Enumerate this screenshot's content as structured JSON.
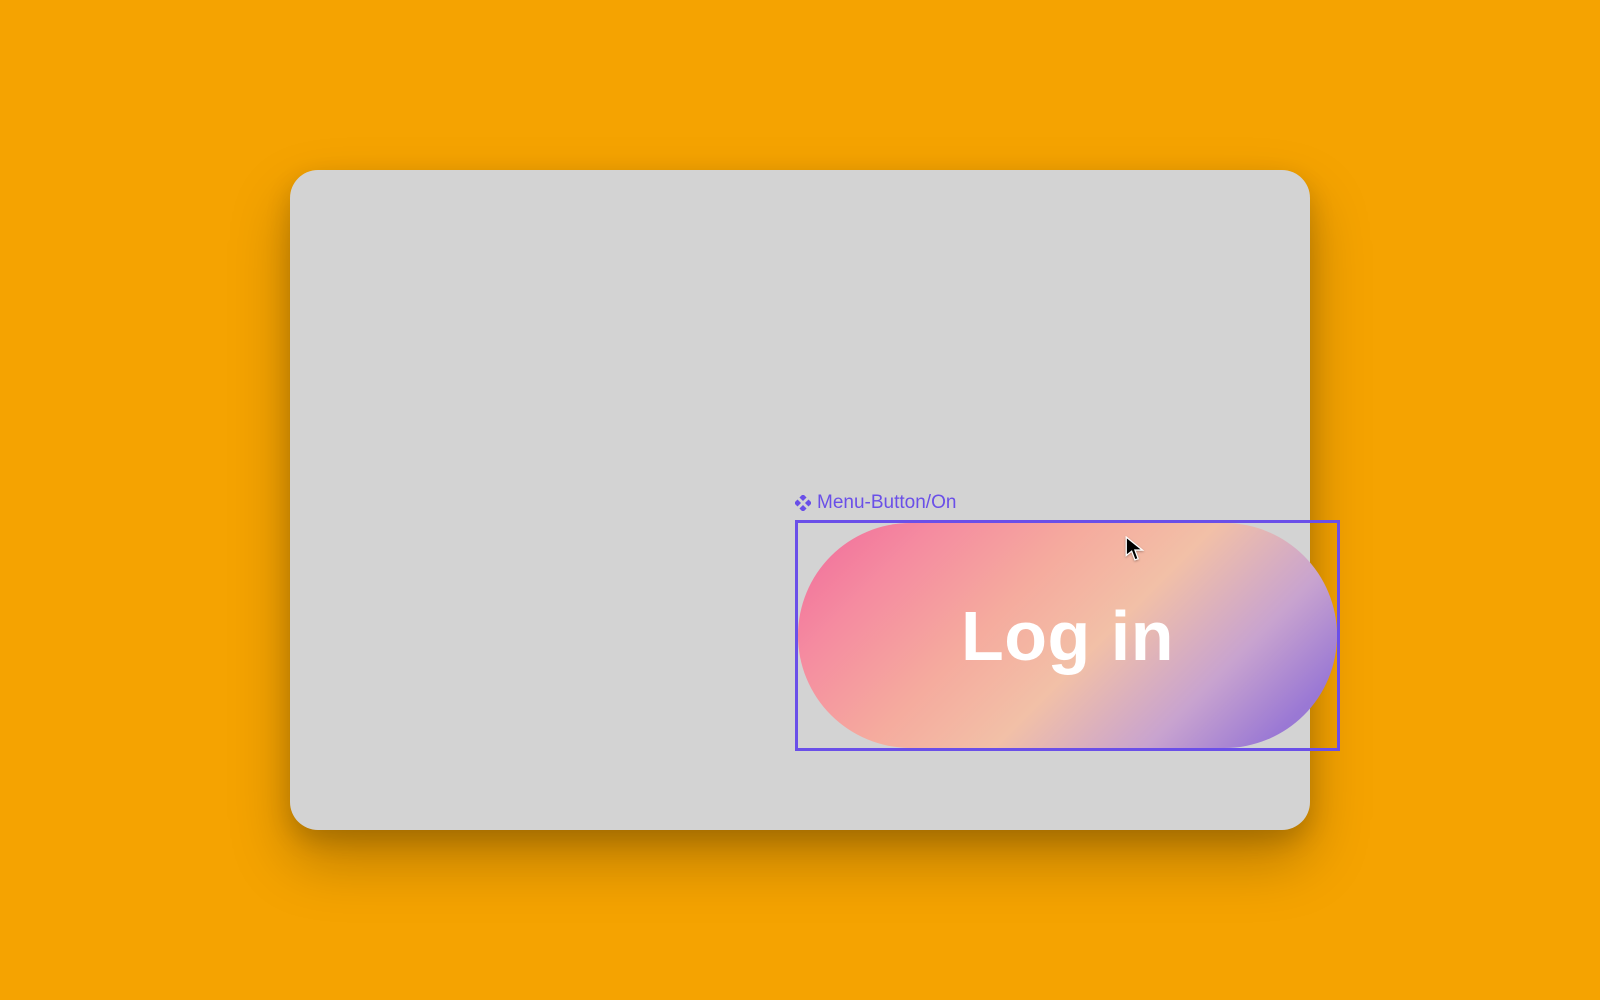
{
  "colors": {
    "page_background": "#f5a301",
    "canvas_background": "#d3d3d3",
    "selection_border": "#6a4fe8",
    "selection_label": "#6a4fe8",
    "button_text": "#ffffff"
  },
  "canvas": {
    "selection": {
      "label": "Menu-Button/On",
      "icon": "component-icon"
    },
    "button": {
      "label": "Log in"
    }
  }
}
